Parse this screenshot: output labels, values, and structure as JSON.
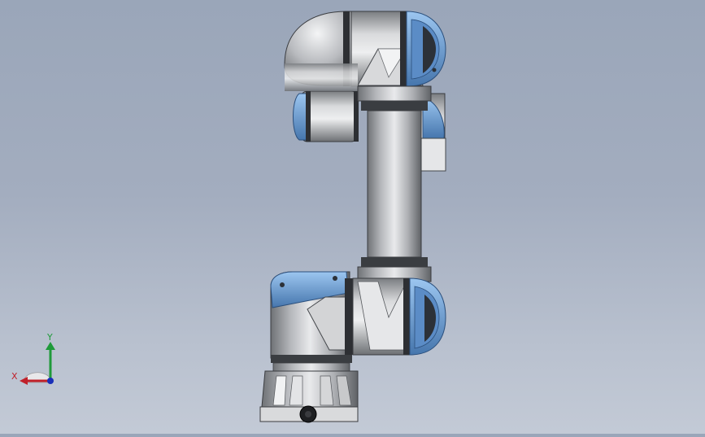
{
  "viewport": {
    "model": "robot-arm-assembly"
  },
  "triad": {
    "x_label": "X",
    "y_label": "Y",
    "x_color": "#c0202a",
    "y_color": "#1f9a3a",
    "z_color": "#1a2fb8"
  },
  "colors": {
    "background_top": "#9aa6b9",
    "background_bottom": "#c3cad6",
    "body_gray": "#b7b9bd",
    "accent_blue": "#6e9fd6",
    "ring_dark": "#2d2f33"
  }
}
